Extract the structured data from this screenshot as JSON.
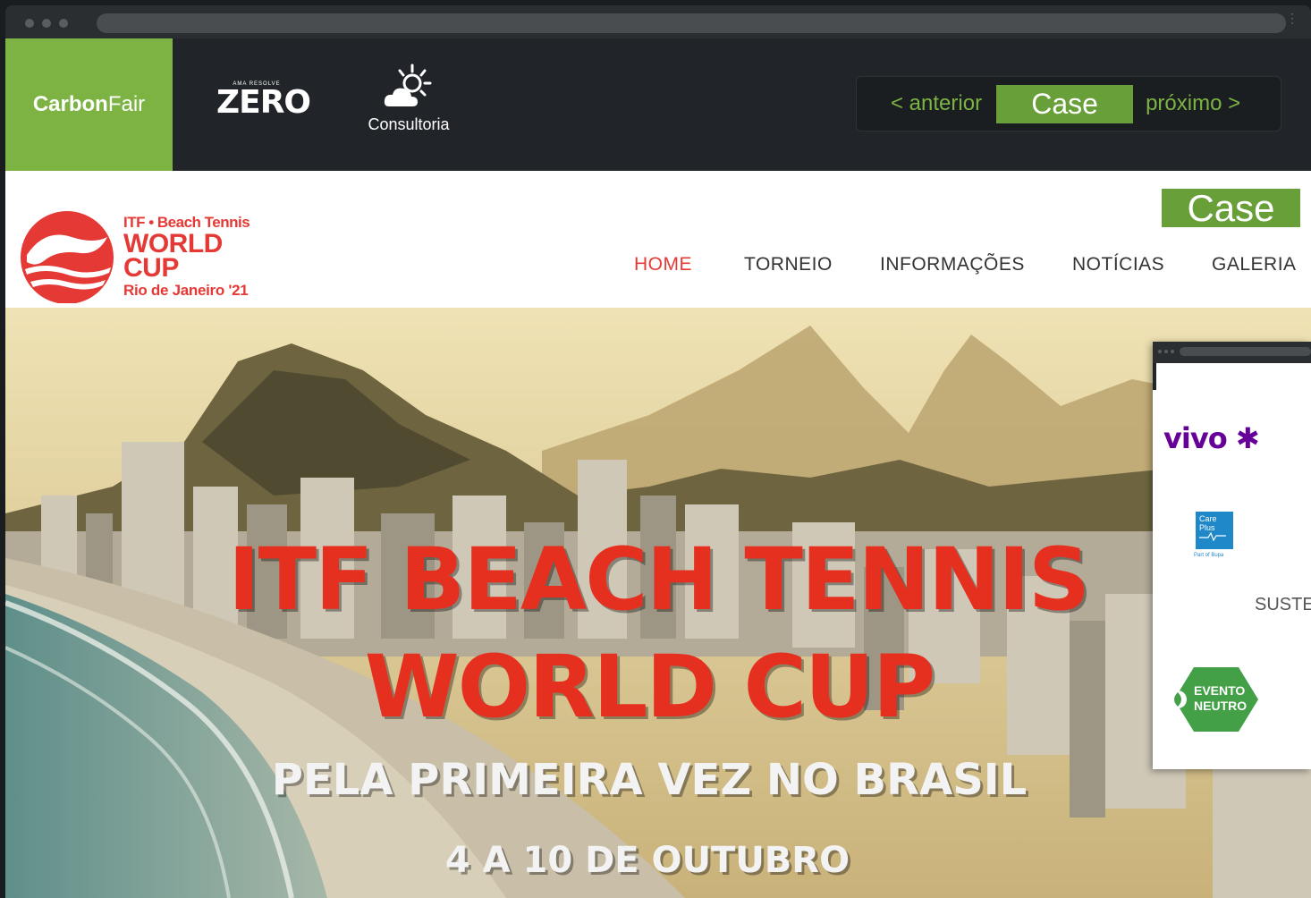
{
  "topbar": {
    "brand_carbon": "Carbon",
    "brand_fair": "Fair",
    "zero_small": "AMA RESOLVE",
    "zero_big": "ZERO",
    "consultoria": "Consultoria",
    "prev_label": "< anterior",
    "case_label": "Case",
    "next_label": "próximo >"
  },
  "site": {
    "case_tag": "Case",
    "logo": {
      "sub": "ITF • Beach Tennis",
      "line1": "WORLD",
      "line2": "CUP",
      "location": "Rio de Janeiro '21"
    },
    "nav": [
      "HOME",
      "TORNEIO",
      "INFORMAÇÕES",
      "NOTÍCIAS",
      "GALERIA"
    ]
  },
  "hero": {
    "line1": "ITF BEACH TENNIS",
    "line2": "WORLD CUP",
    "line3": "PELA PRIMEIRA VEZ NO BRASIL",
    "line4": "4 A 10 DE OUTUBRO"
  },
  "sponsors": {
    "vivo": "vivo",
    "careplus_line1": "Care",
    "careplus_line2": "Plus",
    "careplus_sub": "Part of Bupa",
    "suste": "SUSTE",
    "evento": "EVENTO",
    "neutro": "NEUTRO"
  },
  "colors": {
    "accent_green": "#7cb342",
    "case_green": "#689f38",
    "brand_red": "#e53935",
    "vivo_purple": "#660099"
  }
}
